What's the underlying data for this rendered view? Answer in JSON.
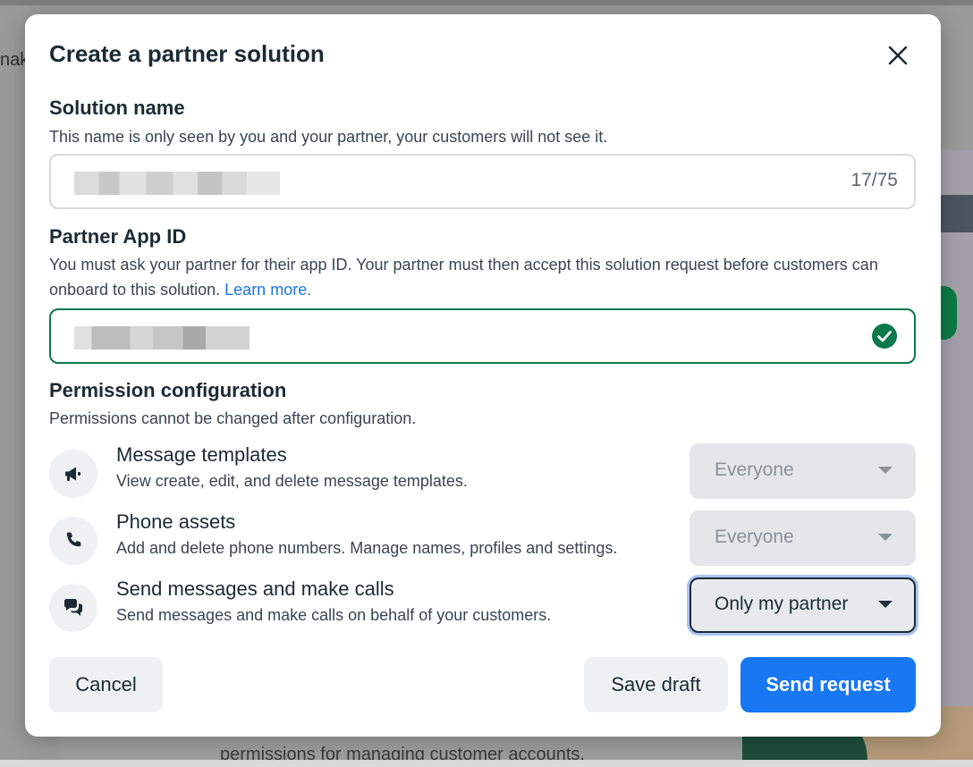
{
  "background": {
    "left_text": "nak",
    "bottom_text": "permissions for managing customer accounts."
  },
  "modal": {
    "title": "Create a partner solution",
    "close_icon": "close-icon"
  },
  "solution_name": {
    "title": "Solution name",
    "description": "This name is only seen by you and your partner, your customers will not see it.",
    "counter": "17/75"
  },
  "partner_app_id": {
    "title": "Partner App ID",
    "description": "You must ask your partner for their app ID. Your partner must then accept this solution request before customers can onboard to this solution.",
    "link": "Learn more.",
    "status_icon": "check-circle-icon",
    "status_color": "#0e7a4b"
  },
  "permissions": {
    "title": "Permission configuration",
    "description": "Permissions cannot be changed after configuration.",
    "items": [
      {
        "icon": "megaphone-icon",
        "name": "Message templates",
        "description": "View create, edit, and delete message templates.",
        "value": "Everyone",
        "enabled": false
      },
      {
        "icon": "phone-icon",
        "name": "Phone assets",
        "description": "Add and delete phone numbers. Manage names, profiles and settings.",
        "value": "Everyone",
        "enabled": false
      },
      {
        "icon": "chat-bubbles-icon",
        "name": "Send messages and make calls",
        "description": "Send messages and make calls on behalf of your customers.",
        "value": "Only my partner",
        "enabled": true
      }
    ]
  },
  "footer": {
    "cancel_label": "Cancel",
    "save_draft_label": "Save draft",
    "send_request_label": "Send request"
  },
  "colors": {
    "primary": "#1877f2",
    "link": "#1b74e4",
    "valid": "#0e7a4b",
    "text": "#1c2b33"
  }
}
